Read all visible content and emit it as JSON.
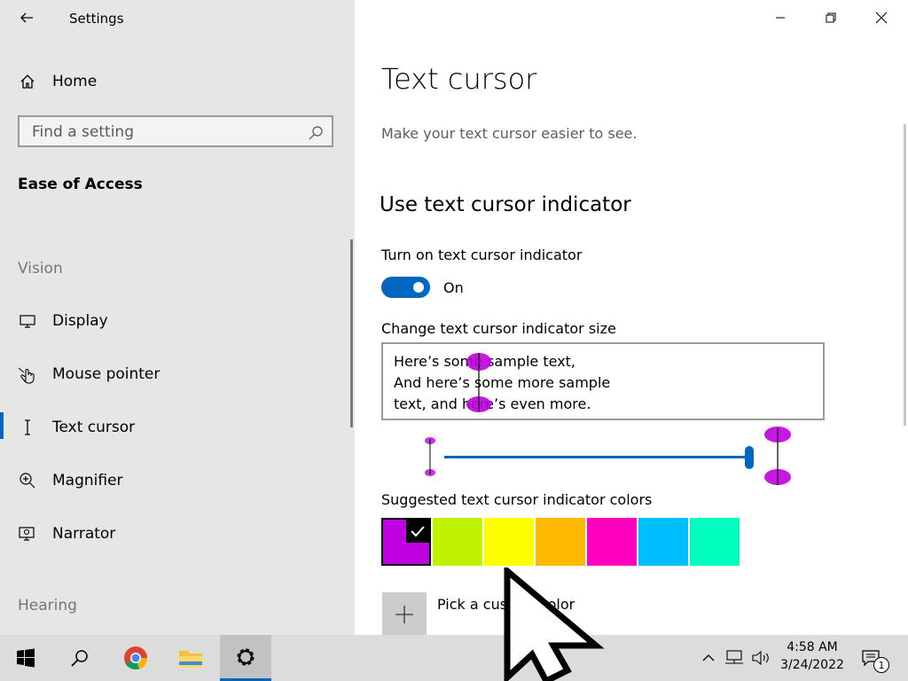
{
  "app": {
    "title": "Settings"
  },
  "nav": {
    "home": "Home",
    "search_placeholder": "Find a setting",
    "section": "Ease of Access",
    "groups": {
      "vision": "Vision",
      "hearing": "Hearing"
    },
    "items": [
      {
        "label": "Display",
        "icon": "monitor-icon",
        "selected": false
      },
      {
        "label": "Mouse pointer",
        "icon": "mouse-pointer-icon",
        "selected": false
      },
      {
        "label": "Text cursor",
        "icon": "text-cursor-icon",
        "selected": true
      },
      {
        "label": "Magnifier",
        "icon": "magnifier-icon",
        "selected": false
      },
      {
        "label": "Narrator",
        "icon": "narrator-icon",
        "selected": false
      }
    ]
  },
  "page": {
    "title": "Text cursor",
    "subtitle": "Make your text cursor easier to see.",
    "indicator_heading": "Use text cursor indicator",
    "toggle_label": "Turn on text cursor indicator",
    "toggle_state": "On",
    "toggle_on": true,
    "size_label": "Change text cursor indicator size",
    "preview_lines": [
      "Here’s some sample text,",
      "And here’s some more sample",
      "text, and here’s even more."
    ],
    "size_level": 1.0,
    "colors_label": "Suggested text cursor indicator colors",
    "swatches": [
      {
        "color": "#bf00e0",
        "selected": true
      },
      {
        "color": "#bff200",
        "selected": false
      },
      {
        "color": "#ffff00",
        "selected": false
      },
      {
        "color": "#ffb900",
        "selected": false
      },
      {
        "color": "#ff00bf",
        "selected": false
      },
      {
        "color": "#00bfff",
        "selected": false
      },
      {
        "color": "#00ffbf",
        "selected": false
      }
    ],
    "custom_color": "Pick a custom color"
  },
  "taskbar": {
    "apps": [
      "start-icon",
      "search-icon",
      "chrome-icon",
      "file-explorer-icon",
      "settings-icon"
    ],
    "time": "4:58 AM",
    "date": "3/24/2022",
    "notifications": "1"
  },
  "colors": {
    "accent": "#0067c0",
    "indicator": "#bf00e0"
  }
}
